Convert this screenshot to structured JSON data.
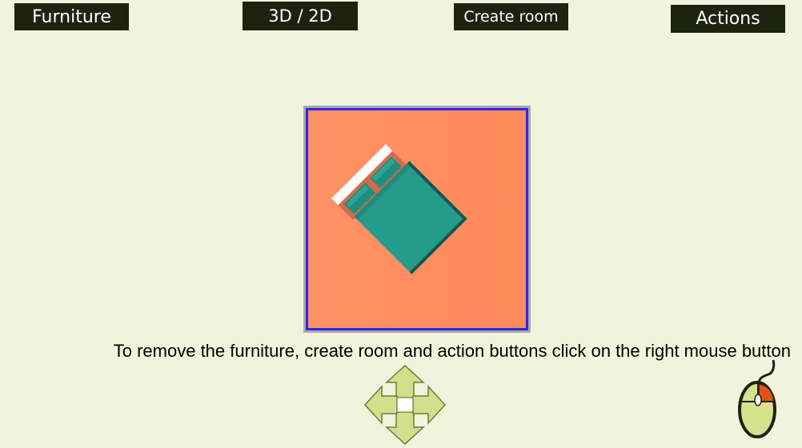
{
  "toolbar": {
    "furniture_label": "Furniture",
    "view_toggle_label": "3D / 2D",
    "create_room_label": "Create room",
    "actions_label": "Actions"
  },
  "preview": {
    "item_icon": "bed-icon"
  },
  "instruction": "To remove the furniture, create room and action buttons click on the right mouse button",
  "icons": {
    "move": "move-arrows-icon",
    "mouse": "mouse-right-click-icon"
  },
  "colors": {
    "background": "#f1f4dc",
    "button_bg": "#1e2310",
    "button_text": "#ffffff",
    "preview_bg": "#fe9168",
    "preview_border": "#2c28ee",
    "bed_color": "#269c8c",
    "arrow_fill": "#d2e08e",
    "mouse_body": "#d6e38e",
    "mouse_button": "#e0521c"
  }
}
